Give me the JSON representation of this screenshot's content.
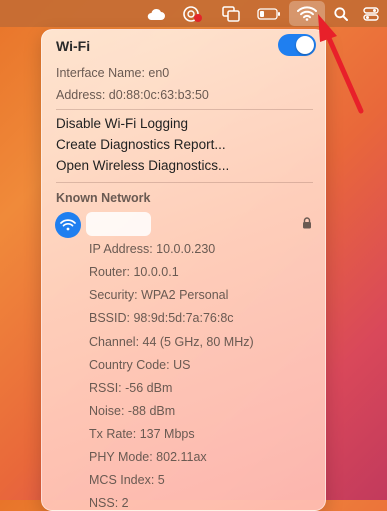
{
  "menubar": {
    "icons": [
      "cloud-icon",
      "screen-record-icon",
      "display-mirror-icon",
      "battery-icon",
      "wifi-icon",
      "spotlight-search-icon",
      "control-center-icon"
    ]
  },
  "wifi_menu": {
    "title": "Wi-Fi",
    "toggle_on": true,
    "interface_name": "Interface Name: en0",
    "address": "Address: d0:88:0c:63:b3:50",
    "actions": [
      "Disable Wi-Fi Logging",
      "Create Diagnostics Report...",
      "Open Wireless Diagnostics..."
    ],
    "known_network_header": "Known Network",
    "details": [
      "IP Address: 10.0.0.230",
      "Router: 10.0.0.1",
      "Security: WPA2 Personal",
      "BSSID: 98:9d:5d:7a:76:8c",
      "Channel: 44 (5 GHz, 80 MHz)",
      "Country Code: US",
      "RSSI: -56 dBm",
      "Noise: -88 dBm",
      "Tx Rate: 137 Mbps",
      "PHY Mode: 802.11ax",
      "MCS Index: 5",
      "NSS: 2"
    ]
  },
  "colors": {
    "accent": "#1f7ff0",
    "arrow": "#e8202a"
  }
}
